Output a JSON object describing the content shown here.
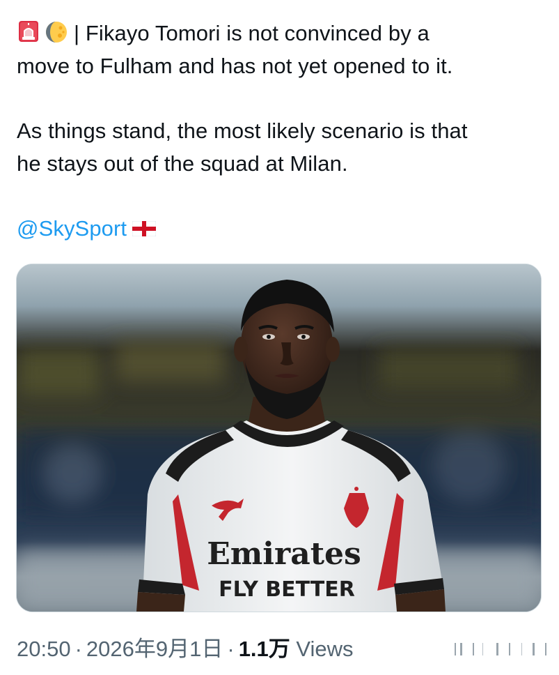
{
  "tweet": {
    "line1_rest": "| Fikayo Tomori is not convinced by a",
    "line2": "move to Fulham and has not yet opened to it.",
    "line3": "As things stand, the most likely scenario is that",
    "line4": "he stays out of the squad at Milan.",
    "mention": "@SkySport"
  },
  "media": {
    "jersey_brand": "Emirates",
    "jersey_tagline": "FLY BETTER"
  },
  "meta": {
    "time": "20:50",
    "separator": "·",
    "date": "2026年9月1日",
    "views_count": "1.1万",
    "views_label": "Views"
  },
  "icons": {
    "siren": "siren-emoji-icon",
    "moon": "waning-moon-emoji-icon",
    "flag": "england-flag-icon"
  },
  "colors": {
    "text": "#0f1419",
    "mention": "#1d9bf0",
    "meta": "#536471",
    "border": "#cfd9de"
  }
}
